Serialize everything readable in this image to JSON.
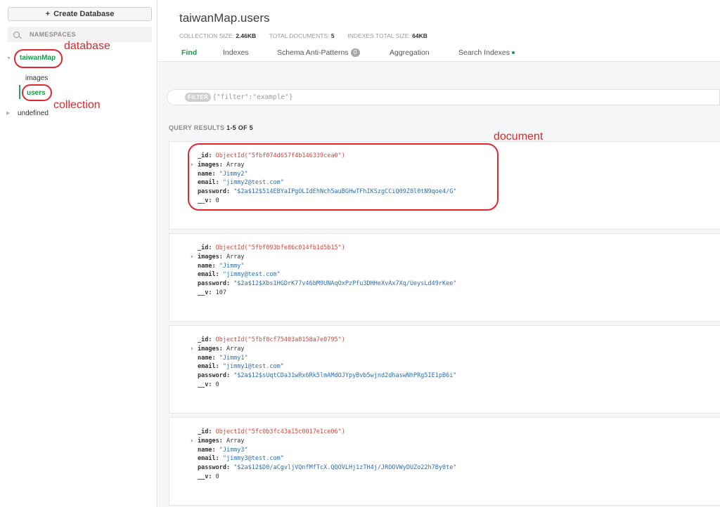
{
  "sidebar": {
    "create_button": "Create Database",
    "namespaces_label": "NAMESPACES",
    "database": "taiwanMap",
    "collections": [
      "images",
      "users"
    ],
    "other_database": "undefined"
  },
  "annotations": {
    "database": "database",
    "collection": "collection",
    "document": "document",
    "color": "#e0272e"
  },
  "header": {
    "title": "taiwanMap.users",
    "stats": {
      "collection_size_label": "COLLECTION SIZE:",
      "collection_size": "2.46KB",
      "total_documents_label": "TOTAL DOCUMENTS:",
      "total_documents": "5",
      "indexes_size_label": "INDEXES TOTAL SIZE:",
      "indexes_size": "64KB"
    },
    "tabs": {
      "find": "Find",
      "indexes": "Indexes",
      "schema": "Schema Anti-Patterns",
      "schema_badge": "0",
      "aggregation": "Aggregation",
      "search": "Search Indexes"
    }
  },
  "filter": {
    "chip": "FILTER",
    "placeholder": "{\"filter\":\"example\"}"
  },
  "results": {
    "label": "QUERY RESULTS",
    "range": "1-5 OF 5"
  },
  "keys": {
    "id": "_id:",
    "images": "images:",
    "name": "name:",
    "email": "email:",
    "password": "password:",
    "v": "__v:"
  },
  "documents": [
    {
      "id": "ObjectId(\"5fbf074d657f4b146339cea0\")",
      "images": "Array",
      "name": "\"Jimmy2\"",
      "email": "\"jimmy2@test.com\"",
      "password": "\"$2a$12$514EBYaIPgOLIdEhNch5auBGHwTFhIKSzgCCiQ09Z0l0tN9qoe4/G\"",
      "v": "0"
    },
    {
      "id": "ObjectId(\"5fbf093bfe86c014fb1d5b15\")",
      "images": "Array",
      "name": "\"Jimmy\"",
      "email": "\"jimmy@test.com\"",
      "password": "\"$2a$12$Xbs1HGDrK77v46bM9UNAqOxPzPfu3DHHeXvAx7Xq/UeysLd49rKee\"",
      "v": "107"
    },
    {
      "id": "ObjectId(\"5fbf0cf75403a8158a7e0795\")",
      "images": "Array",
      "name": "\"Jimmy1\"",
      "email": "\"jimmy1@test.com\"",
      "password": "\"$2a$12$sUqtCDa31wRx6Rk5lmAMdOJYpyBvb5wjnd2dhaswNhPRg5IE1pB6i\"",
      "v": "0"
    },
    {
      "id": "ObjectId(\"5fc0b3fc43a15c0017e1ce06\")",
      "images": "Array",
      "name": "\"Jimmy3\"",
      "email": "\"jimmy3@test.com\"",
      "password": "\"$2a$12$D0/aCgvljVQnfMfTcX.QQOVLHj1zTH4j/JROOVWyDUZo22h7By0te\"",
      "v": "0"
    }
  ]
}
